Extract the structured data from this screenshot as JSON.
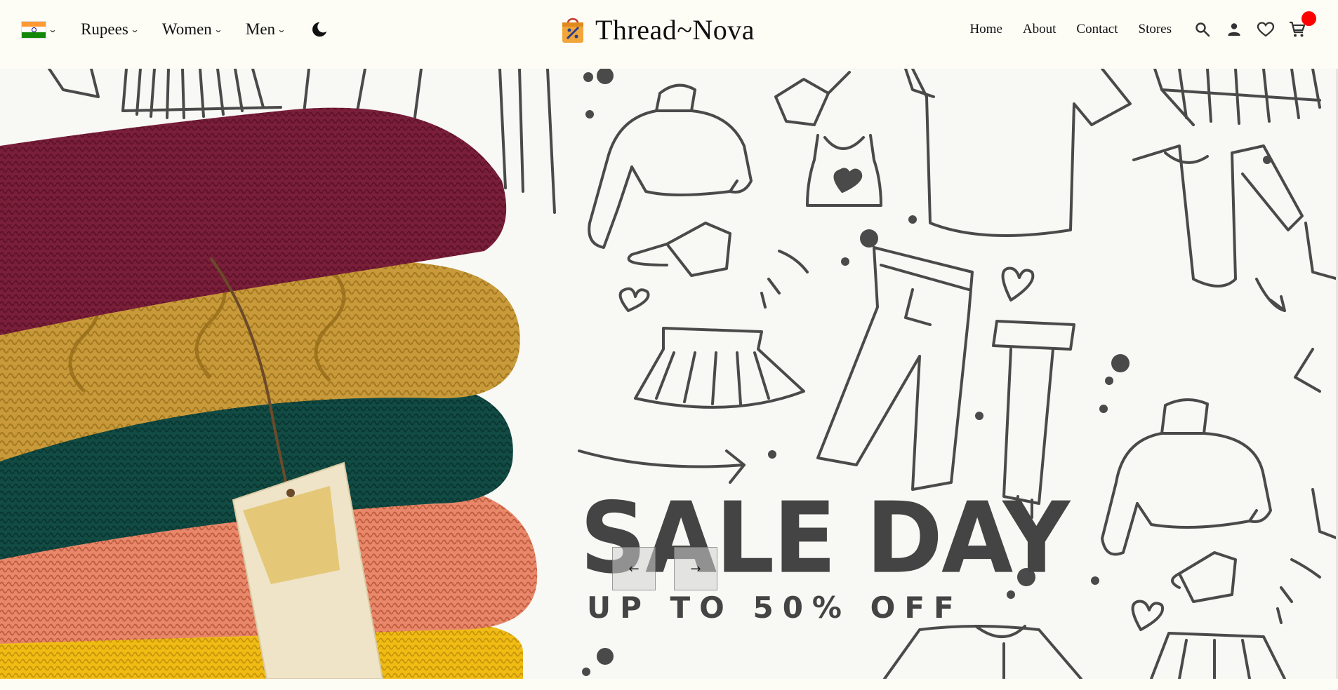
{
  "header": {
    "currency_label": "Rupees",
    "women_label": "Women",
    "men_label": "Men",
    "brand_name": "Thread~Nova",
    "nav_links": [
      {
        "label": "Home"
      },
      {
        "label": "About"
      },
      {
        "label": "Contact"
      },
      {
        "label": "Stores"
      }
    ],
    "icons": [
      "india-flag-icon",
      "moon-icon",
      "search-icon",
      "user-icon",
      "heart-icon",
      "cart-icon"
    ]
  },
  "hero": {
    "headline": "SALE DAY",
    "subheadline": "UP TO 50% OFF",
    "prev_label": "←",
    "next_label": "→"
  },
  "colors": {
    "accent_badge": "#ff0000",
    "headline": "#444444",
    "background": "#fdfdf6"
  }
}
